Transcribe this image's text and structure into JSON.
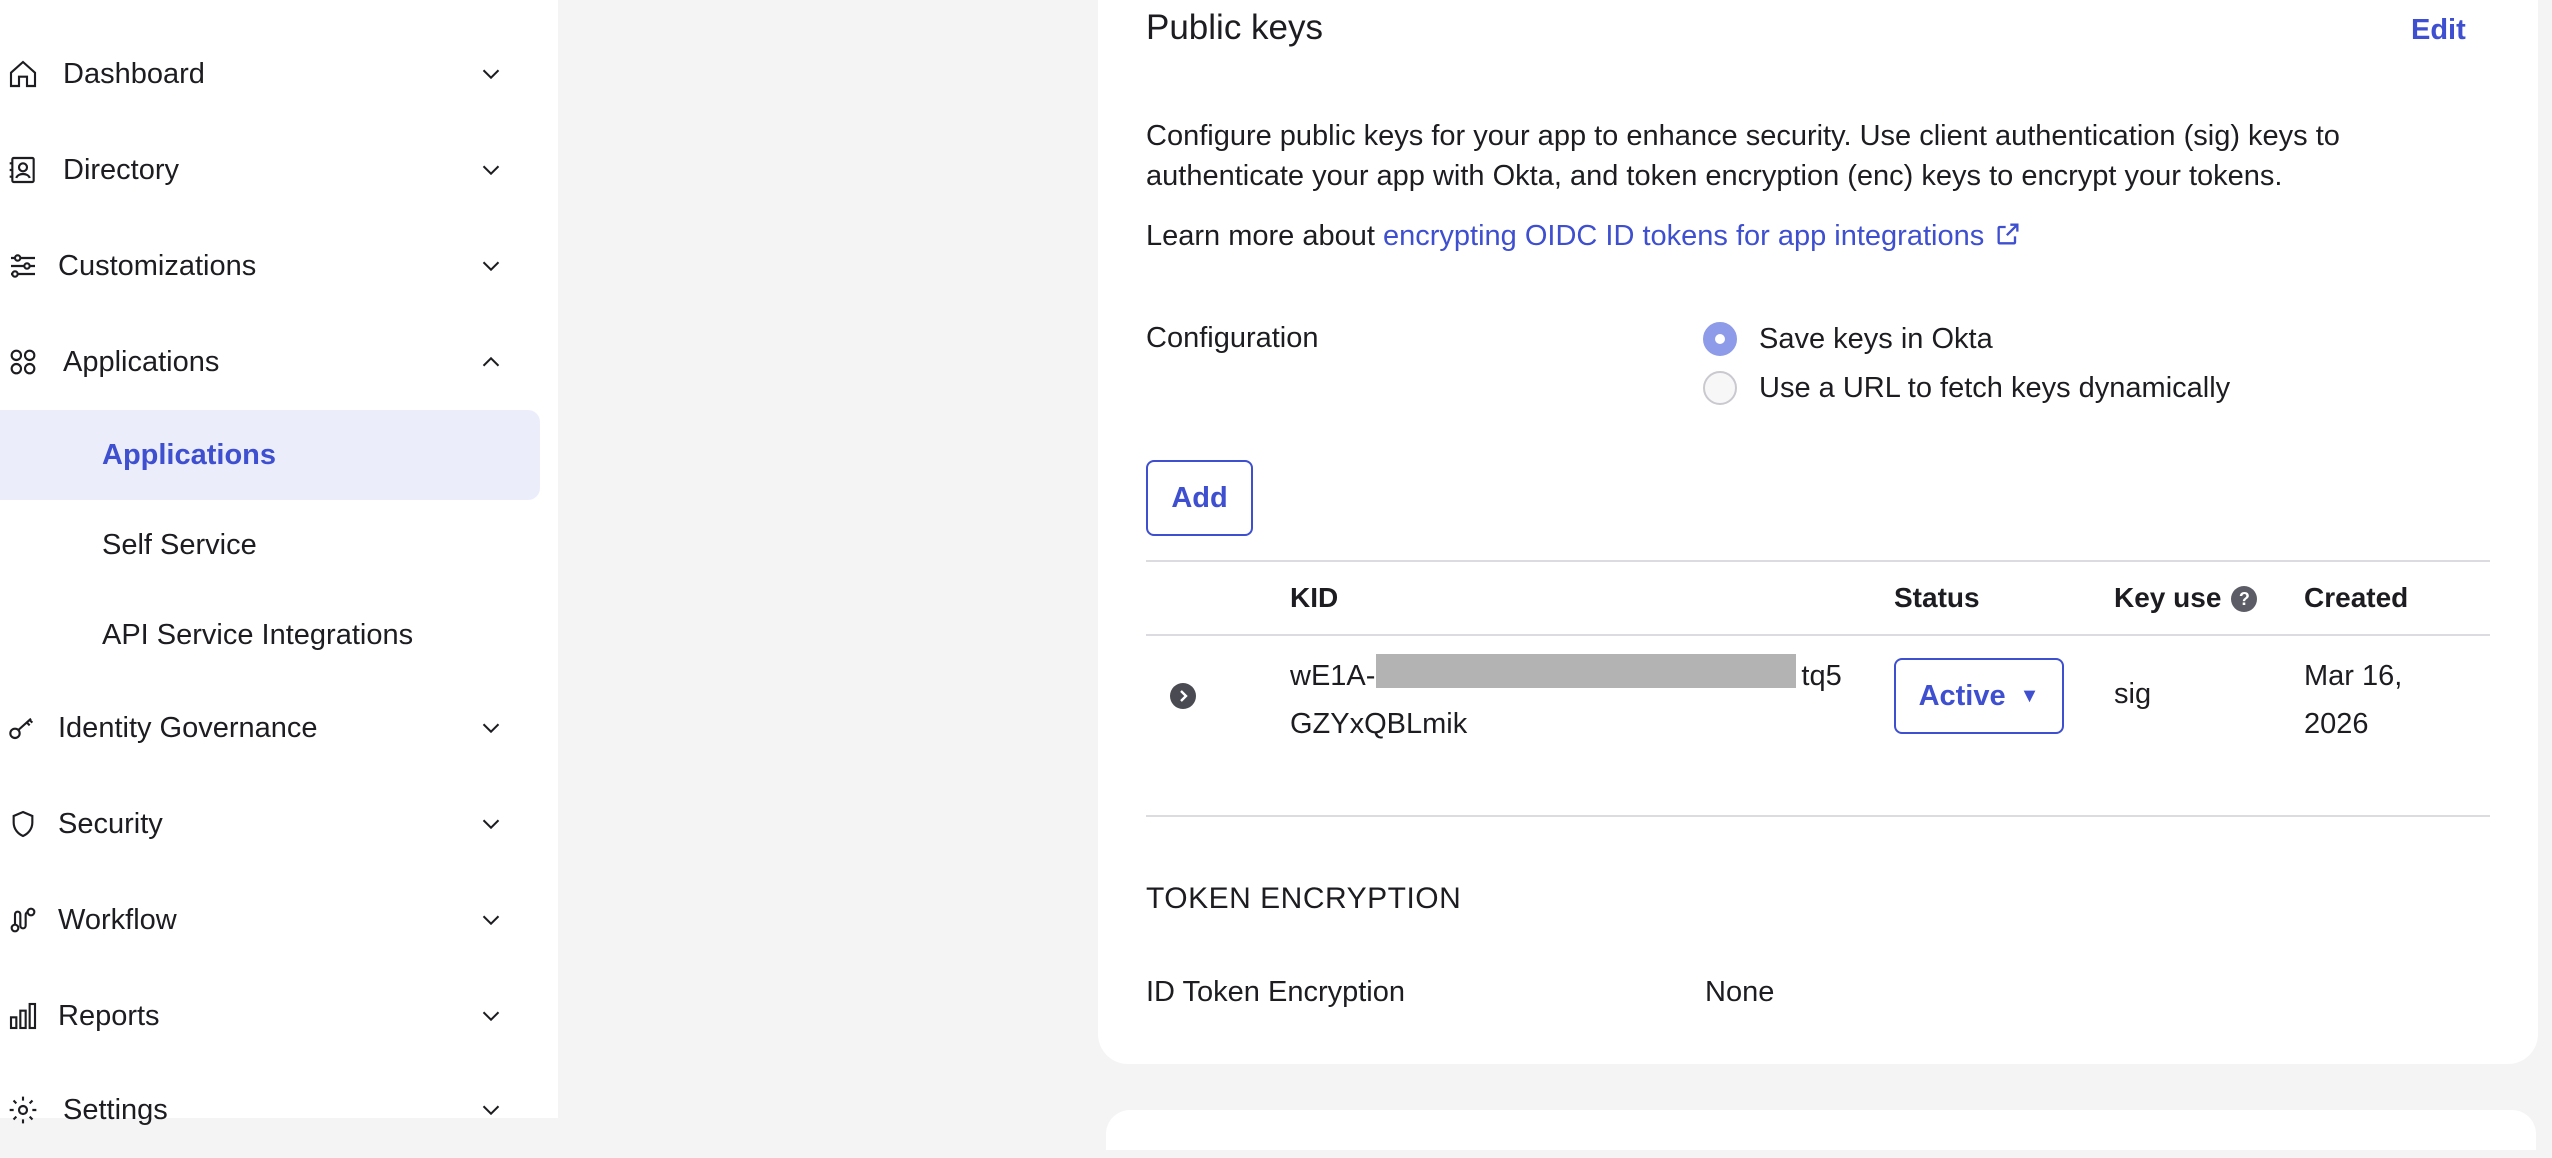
{
  "sidebar": {
    "items": [
      {
        "label": "Dashboard",
        "icon": "home-icon"
      },
      {
        "label": "Directory",
        "icon": "directory-icon"
      },
      {
        "label": "Customizations",
        "icon": "sliders-icon"
      },
      {
        "label": "Applications",
        "icon": "grid-icon"
      },
      {
        "label": "Identity Governance",
        "icon": "key-icon"
      },
      {
        "label": "Security",
        "icon": "shield-icon"
      },
      {
        "label": "Workflow",
        "icon": "workflow-icon"
      },
      {
        "label": "Reports",
        "icon": "chart-icon"
      },
      {
        "label": "Settings",
        "icon": "gear-icon"
      }
    ],
    "applications_sub": [
      {
        "label": "Applications",
        "active": true
      },
      {
        "label": "Self Service",
        "active": false
      },
      {
        "label": "API Service Integrations",
        "active": false
      }
    ]
  },
  "public_keys": {
    "title": "Public keys",
    "edit_label": "Edit",
    "description": "Configure public keys for your app to enhance security. Use client authentication (sig) keys to authenticate your app with Okta, and token encryption (enc) keys to encrypt your tokens.",
    "learn_prefix": "Learn more about ",
    "learn_link": "encrypting OIDC ID tokens for app integrations",
    "configuration_label": "Configuration",
    "options": [
      {
        "label": "Save keys in Okta",
        "selected": true
      },
      {
        "label": "Use a URL to fetch keys dynamically",
        "selected": false
      }
    ],
    "add_label": "Add",
    "table": {
      "headers": [
        "KID",
        "Status",
        "Key use",
        "Created"
      ],
      "rows": [
        {
          "kid_line1_start": "wE1A-",
          "kid_line1_end": "tq5",
          "kid_line2": "GZYxQBLmik",
          "status": "Active",
          "key_use": "sig",
          "created_line1": "Mar 16,",
          "created_line2": "2026"
        }
      ]
    }
  },
  "token_encryption": {
    "title": "TOKEN ENCRYPTION",
    "id_token_label": "ID Token Encryption",
    "id_token_value": "None"
  },
  "colors": {
    "accent": "#3e4fd0",
    "active_nav_bg": "#ebedfb",
    "page_bg": "#f4f4f5"
  }
}
